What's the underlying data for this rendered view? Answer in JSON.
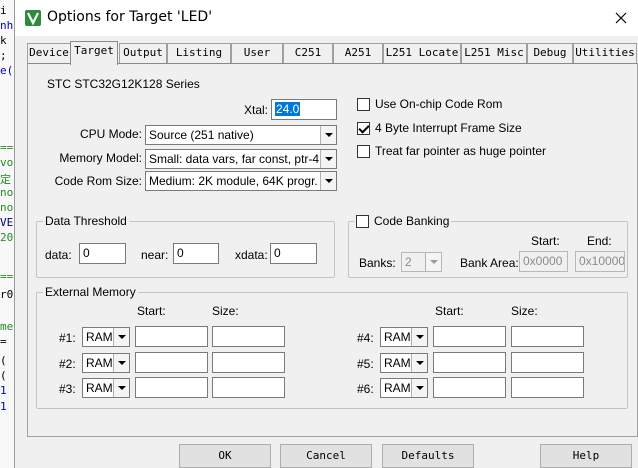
{
  "background_editor": {
    "lines": [
      "i",
      "nhi",
      " k",
      ";",
      "e(",
      "==",
      "vo",
      "定",
      "no",
      "no",
      "VE",
      "20",
      "==",
      "r0",
      "me",
      " =",
      " (",
      " (",
      " 1",
      " 1"
    ]
  },
  "window": {
    "title": "Options for Target 'LED'"
  },
  "tabs": [
    {
      "label": "Device"
    },
    {
      "label": "Target"
    },
    {
      "label": "Output"
    },
    {
      "label": "Listing"
    },
    {
      "label": "User"
    },
    {
      "label": "C251"
    },
    {
      "label": "A251"
    },
    {
      "label": "L251 Locate"
    },
    {
      "label": "L251 Misc"
    },
    {
      "label": "Debug"
    },
    {
      "label": "Utilities"
    }
  ],
  "target": {
    "device_name": "STC STC32G12K128 Series",
    "xtal": {
      "label": "Xtal:",
      "value": "24.0"
    },
    "cpu_mode": {
      "label": "CPU Mode:",
      "value": "Source (251 native)"
    },
    "memory_model": {
      "label": "Memory Model:",
      "value": "Small: data vars, far const, ptr-4"
    },
    "code_rom_size": {
      "label": "Code Rom Size:",
      "value": "Medium: 2K module, 64K progr."
    },
    "options": [
      {
        "label": "Use On-chip Code Rom",
        "checked": false
      },
      {
        "label": "4 Byte Interrupt Frame Size",
        "checked": true
      },
      {
        "label": "Treat far pointer as huge pointer",
        "checked": false
      }
    ],
    "data_threshold": {
      "title": "Data Threshold",
      "data_label": "data:",
      "data_value": "0",
      "near_label": "near:",
      "near_value": "0",
      "xdata_label": "xdata:",
      "xdata_value": "0"
    },
    "code_banking": {
      "label": "Code Banking",
      "banks_label": "Banks:",
      "banks_value": "2",
      "bank_area_label": "Bank Area:",
      "start_header": "Start:",
      "end_header": "End:",
      "start_value": "0x0000",
      "end_value": "0x10000"
    },
    "external_memory": {
      "title": "External Memory",
      "start_header": "Start:",
      "size_header": "Size:",
      "rows": [
        {
          "label": "#1:",
          "type": "RAM",
          "start": "",
          "size": ""
        },
        {
          "label": "#2:",
          "type": "RAM",
          "start": "",
          "size": ""
        },
        {
          "label": "#3:",
          "type": "RAM",
          "start": "",
          "size": ""
        },
        {
          "label": "#4:",
          "type": "RAM",
          "start": "",
          "size": ""
        },
        {
          "label": "#5:",
          "type": "RAM",
          "start": "",
          "size": ""
        },
        {
          "label": "#6:",
          "type": "RAM",
          "start": "",
          "size": ""
        }
      ]
    }
  },
  "buttons": {
    "ok": "OK",
    "cancel": "Cancel",
    "defaults": "Defaults",
    "help": "Help"
  },
  "colors": {
    "dialog_bg": "#f0f0f0",
    "selection": "#0078d7",
    "icon_green": "#2e8b3a"
  }
}
